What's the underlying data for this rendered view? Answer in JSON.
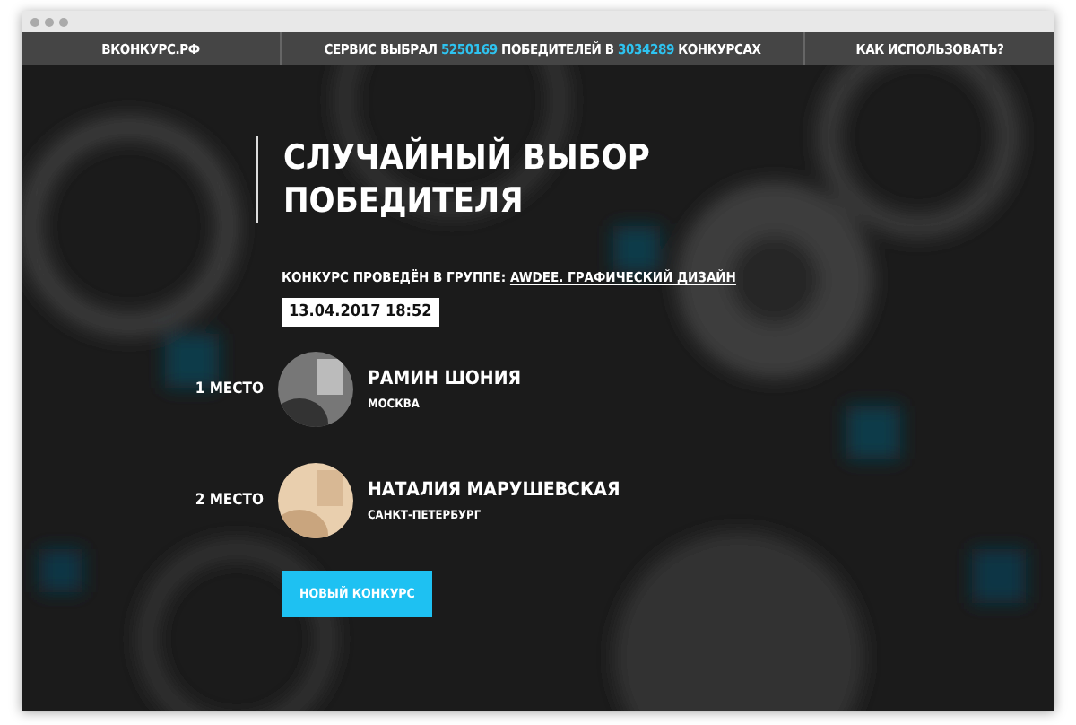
{
  "nav": {
    "site": "ВКОНКУРС.РФ",
    "stats": [
      {
        "kind": "text",
        "text": "СЕРВИС ВЫБРАЛ "
      },
      {
        "kind": "number",
        "text": "5250169"
      },
      {
        "kind": "text",
        "text": " ПОБЕДИТЕЛЕЙ В "
      },
      {
        "kind": "number",
        "text": "3034289"
      },
      {
        "kind": "text",
        "text": " КОНКУРСАХ"
      }
    ],
    "help": "КАК ИСПОЛЬЗОВАТЬ?"
  },
  "title": "СЛУЧАЙНЫЙ ВЫБОР ПОБЕДИТЕЛЯ",
  "group": {
    "label": "КОНКУРС ПРОВЕДЁН В ГРУППЕ:",
    "link": "AWDEE. ГРАФИЧЕСКИЙ ДИЗАЙН"
  },
  "date": "13.04.2017 18:52",
  "winners": [
    {
      "place": "1 МЕСТО",
      "name": "РАМИН ШОНИЯ",
      "city": "МОСКВА"
    },
    {
      "place": "2 МЕСТО",
      "name": "НАТАЛИЯ МАРУШЕВСКАЯ",
      "city": "САНКТ-ПЕТЕРБУРГ"
    }
  ],
  "button": "НОВЫЙ КОНКУРС"
}
